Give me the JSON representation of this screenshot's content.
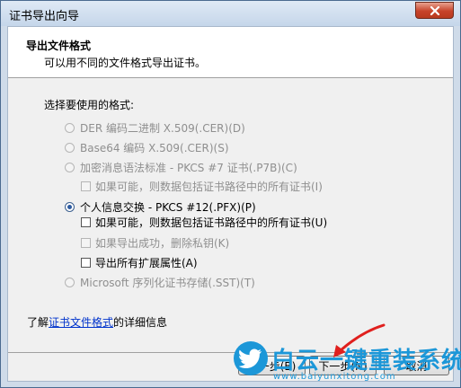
{
  "window": {
    "title": "证书导出向导"
  },
  "header": {
    "title": "导出文件格式",
    "subtitle": "可以用不同的文件格式导出证书。"
  },
  "format_section": {
    "label": "选择要使用的格式:",
    "options": [
      {
        "label": "DER 编码二进制 X.509(.CER)(D)",
        "selected": false,
        "enabled": false
      },
      {
        "label": "Base64 编码 X.509(.CER)(S)",
        "selected": false,
        "enabled": false
      },
      {
        "label": "加密消息语法标准 - PKCS #7 证书(.P7B)(C)",
        "selected": false,
        "enabled": false
      },
      {
        "label": "个人信息交换 - PKCS #12(.PFX)(P)",
        "selected": true,
        "enabled": true
      },
      {
        "label": "Microsoft 序列化证书存储(.SST)(T)",
        "selected": false,
        "enabled": false
      }
    ],
    "p7b_include_all": {
      "label": "如果可能，则数据包括证书路径中的所有证书(I)",
      "checked": false,
      "enabled": false
    },
    "pfx_include_all": {
      "label": "如果可能，则数据包括证书路径中的所有证书(U)",
      "checked": false,
      "enabled": true
    },
    "pfx_delete_key": {
      "label": "如果导出成功，删除私钥(K)",
      "checked": false,
      "enabled": false
    },
    "pfx_export_ext": {
      "label": "导出所有扩展属性(A)",
      "checked": false,
      "enabled": true
    }
  },
  "info": {
    "prefix": "了解",
    "link": "证书文件格式",
    "suffix": "的详细信息"
  },
  "buttons": {
    "back": "上一步(B)",
    "next": "下一步(N)",
    "cancel": "取消"
  },
  "watermark": {
    "text": "白云一键重装系统",
    "url": "www.baiyunxitong.com"
  },
  "colors": {
    "accent": "#1c97d8",
    "link": "#0033cc",
    "arrow": "#e0201e"
  }
}
